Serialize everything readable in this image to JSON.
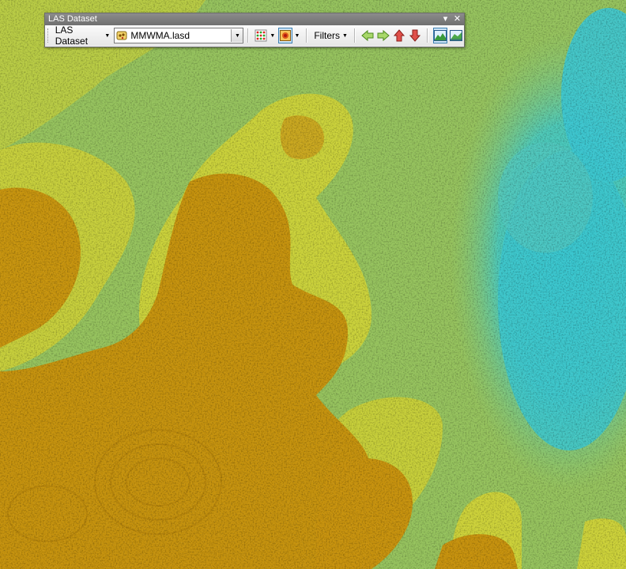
{
  "window": {
    "title": "LAS Dataset"
  },
  "toolbar": {
    "las_dataset_menu": "LAS Dataset",
    "dataset_combo_value": "MMWMA.lasd",
    "filters_menu": "Filters"
  },
  "icons": {
    "dataset": "las-dataset-file-icon",
    "point_symbology": "point-symbology-icon",
    "surface_symbology": "surface-symbology-icon",
    "nav": [
      "arrow-left-icon",
      "arrow-right-icon",
      "arrow-up-icon",
      "arrow-down-icon"
    ],
    "views": [
      "profile-view-icon",
      "3d-view-icon"
    ]
  },
  "colors": {
    "titlebar": "#7a7a7a",
    "map_low": "#3fc7c4",
    "map_mid": "#9fc65c",
    "map_high_yellow": "#cfd23a",
    "map_high_orange": "#c9960f"
  }
}
